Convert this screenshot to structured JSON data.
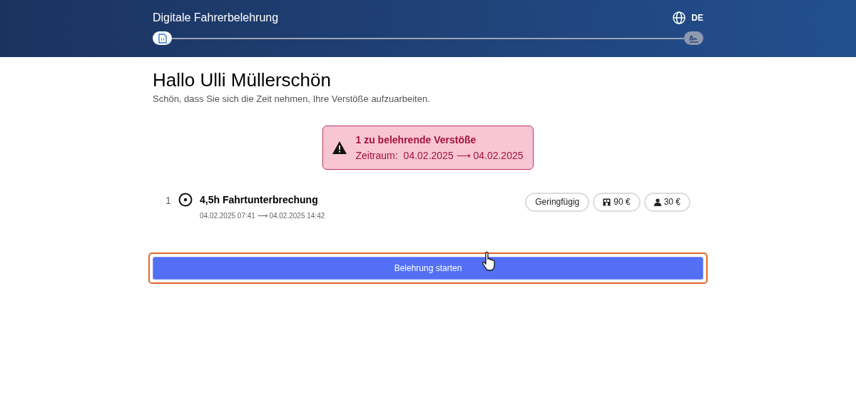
{
  "header": {
    "title": "Digitale Fahrerbelehrung",
    "language": "DE",
    "steps": [
      {
        "kind": "document",
        "selected": true
      },
      {
        "kind": "signature",
        "selected": false
      }
    ]
  },
  "greeting": {
    "title": "Hallo Ulli Müllerschön",
    "subtitle": "Schön, dass Sie sich die Zeit nehmen, Ihre Verstöße aufzuarbeiten."
  },
  "alert": {
    "title": "1 zu belehrende Verstöße",
    "period_label": "Zeitraum:",
    "period": "04.02.2025 ⟶ 04.02.2025"
  },
  "violations": [
    {
      "number": "1",
      "title": "4,5h Fahrtunterbrechung",
      "time": "04.02.2025 07:41 ⟶ 04.02.2025 14:42",
      "tags": [
        {
          "kind": "severity",
          "label": "Geringfügig"
        },
        {
          "kind": "company",
          "label": "90 €"
        },
        {
          "kind": "driver",
          "label": "30 €"
        }
      ]
    }
  ],
  "start_button": {
    "label": "Belehrung starten",
    "focused": true
  }
}
